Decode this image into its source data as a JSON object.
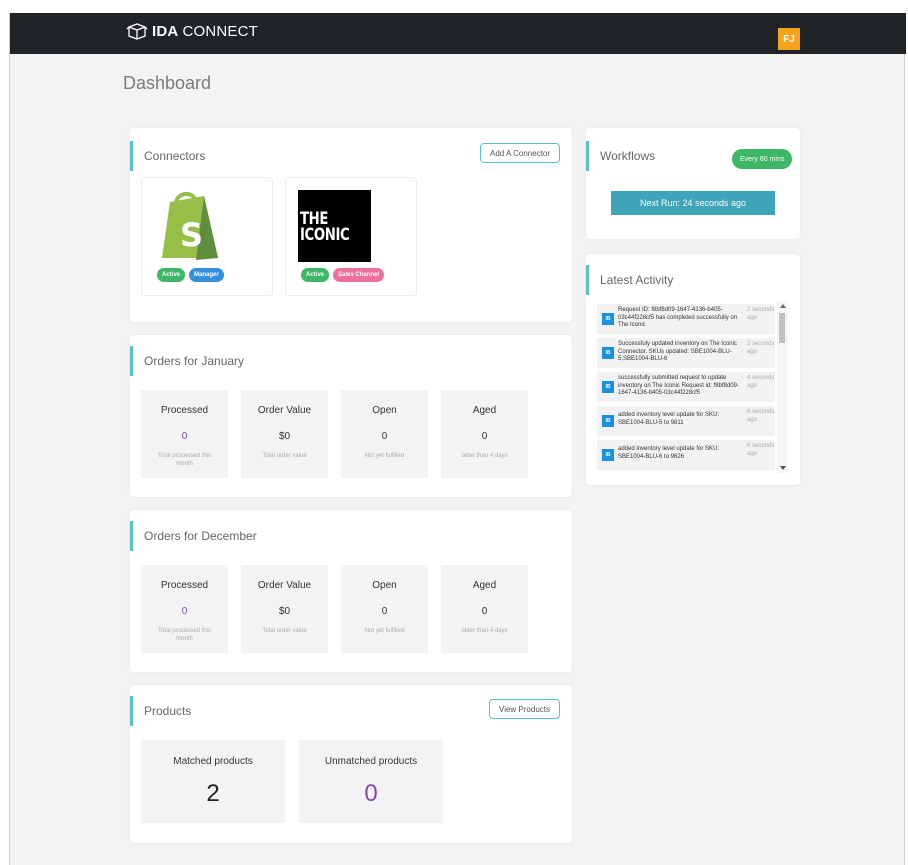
{
  "header": {
    "logo_bold": "IDA",
    "logo_rest": "CONNECT",
    "user_initials": "FJ"
  },
  "page": {
    "title": "Dashboard"
  },
  "connectors": {
    "title": "Connectors",
    "add_label": "Add A Connector",
    "items": [
      {
        "name": "shopify-icon",
        "badges": [
          "Active",
          "Manager"
        ]
      },
      {
        "logo_lines": [
          "THE",
          "ICONIC"
        ],
        "badges": [
          "Active",
          "Sales Channel"
        ]
      }
    ]
  },
  "orders_january": {
    "title": "Orders for January",
    "stats": [
      {
        "label": "Processed",
        "value": "0",
        "sub": "Total processed this month"
      },
      {
        "label": "Order Value",
        "value": "$0",
        "sub": "Total order value"
      },
      {
        "label": "Open",
        "value": "0",
        "sub": "Not yet fulfilled"
      },
      {
        "label": "Aged",
        "value": "0",
        "sub": "older than 4 days"
      }
    ]
  },
  "orders_december": {
    "title": "Orders for December",
    "stats": [
      {
        "label": "Processed",
        "value": "0",
        "sub": "Total processed this month"
      },
      {
        "label": "Order Value",
        "value": "$0",
        "sub": "Total order value"
      },
      {
        "label": "Open",
        "value": "0",
        "sub": "Not yet fulfilled"
      },
      {
        "label": "Aged",
        "value": "0",
        "sub": "older than 4 days"
      }
    ]
  },
  "products": {
    "title": "Products",
    "view_label": "View Products",
    "matched_label": "Matched products",
    "matched_value": "2",
    "unmatched_label": "Unmatched products",
    "unmatched_value": "0"
  },
  "workflows": {
    "title": "Workflows",
    "frequency": "Every 60 mins",
    "next_run": "Next Run: 24 seconds ago"
  },
  "activity": {
    "title": "Latest Activity",
    "icon_text": "IB",
    "items": [
      {
        "text": "Request ID: f8bf8d09-1647-4136-b405-03c44f228cf5 has completed successfully on The Iconic",
        "time": "2 seconds ago"
      },
      {
        "text": "Successfuly updated inventory on The Iconic Connector. SKUs updated: SBE1004-BLU-5,SBE1004-BLU-6",
        "time": "2 seconds ago"
      },
      {
        "text": "successfully submitted request to update inventory on The Iconic Request id: f8bf8d09-1647-4136-b405-03c44f228cf5",
        "time": "4 seconds ago"
      },
      {
        "text": "added inventory level update for SKU: SBE1004-BLU-5 to 9811",
        "time": "6 seconds ago"
      },
      {
        "text": "added inventory level update for SKU: SBE1004-BLU-6 to 9626",
        "time": "6 seconds ago"
      }
    ]
  },
  "colors": {
    "accent": "#58c3c0",
    "topbar": "#212427",
    "active": "#3db665",
    "manager": "#3490dc",
    "sales_channel": "#ef6f9a",
    "next_run": "#3ea4b8",
    "avatar": "#f7a21b"
  }
}
